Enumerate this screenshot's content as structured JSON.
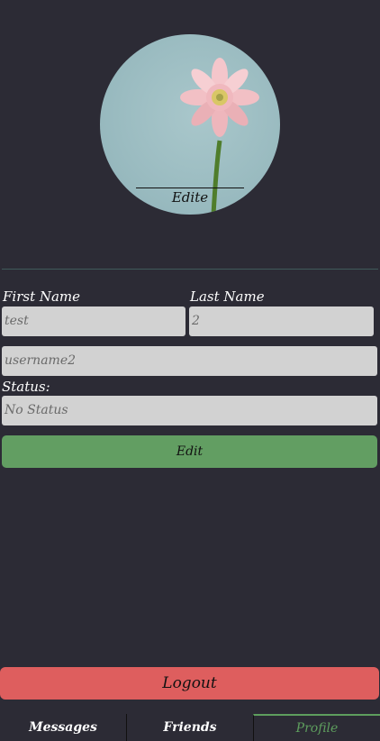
{
  "avatar": {
    "edit_label": "Edite"
  },
  "form": {
    "first_name_label": "First Name",
    "last_name_label": "Last Name",
    "first_name_value": "test",
    "last_name_value": "2",
    "username_value": "username2",
    "status_label": "Status:",
    "status_value": "No Status"
  },
  "edit_button_label": "Edit",
  "logout_button_label": "Logout",
  "tabs": [
    {
      "label": "Messages",
      "active": false
    },
    {
      "label": "Friends",
      "active": false
    },
    {
      "label": "Profile",
      "active": true
    }
  ],
  "colors": {
    "background": "#2c2b35",
    "edit_button": "#629e62",
    "logout_button": "#de5e5e",
    "active_tab": "#5e9e5e",
    "field": "#d2d2d2"
  }
}
